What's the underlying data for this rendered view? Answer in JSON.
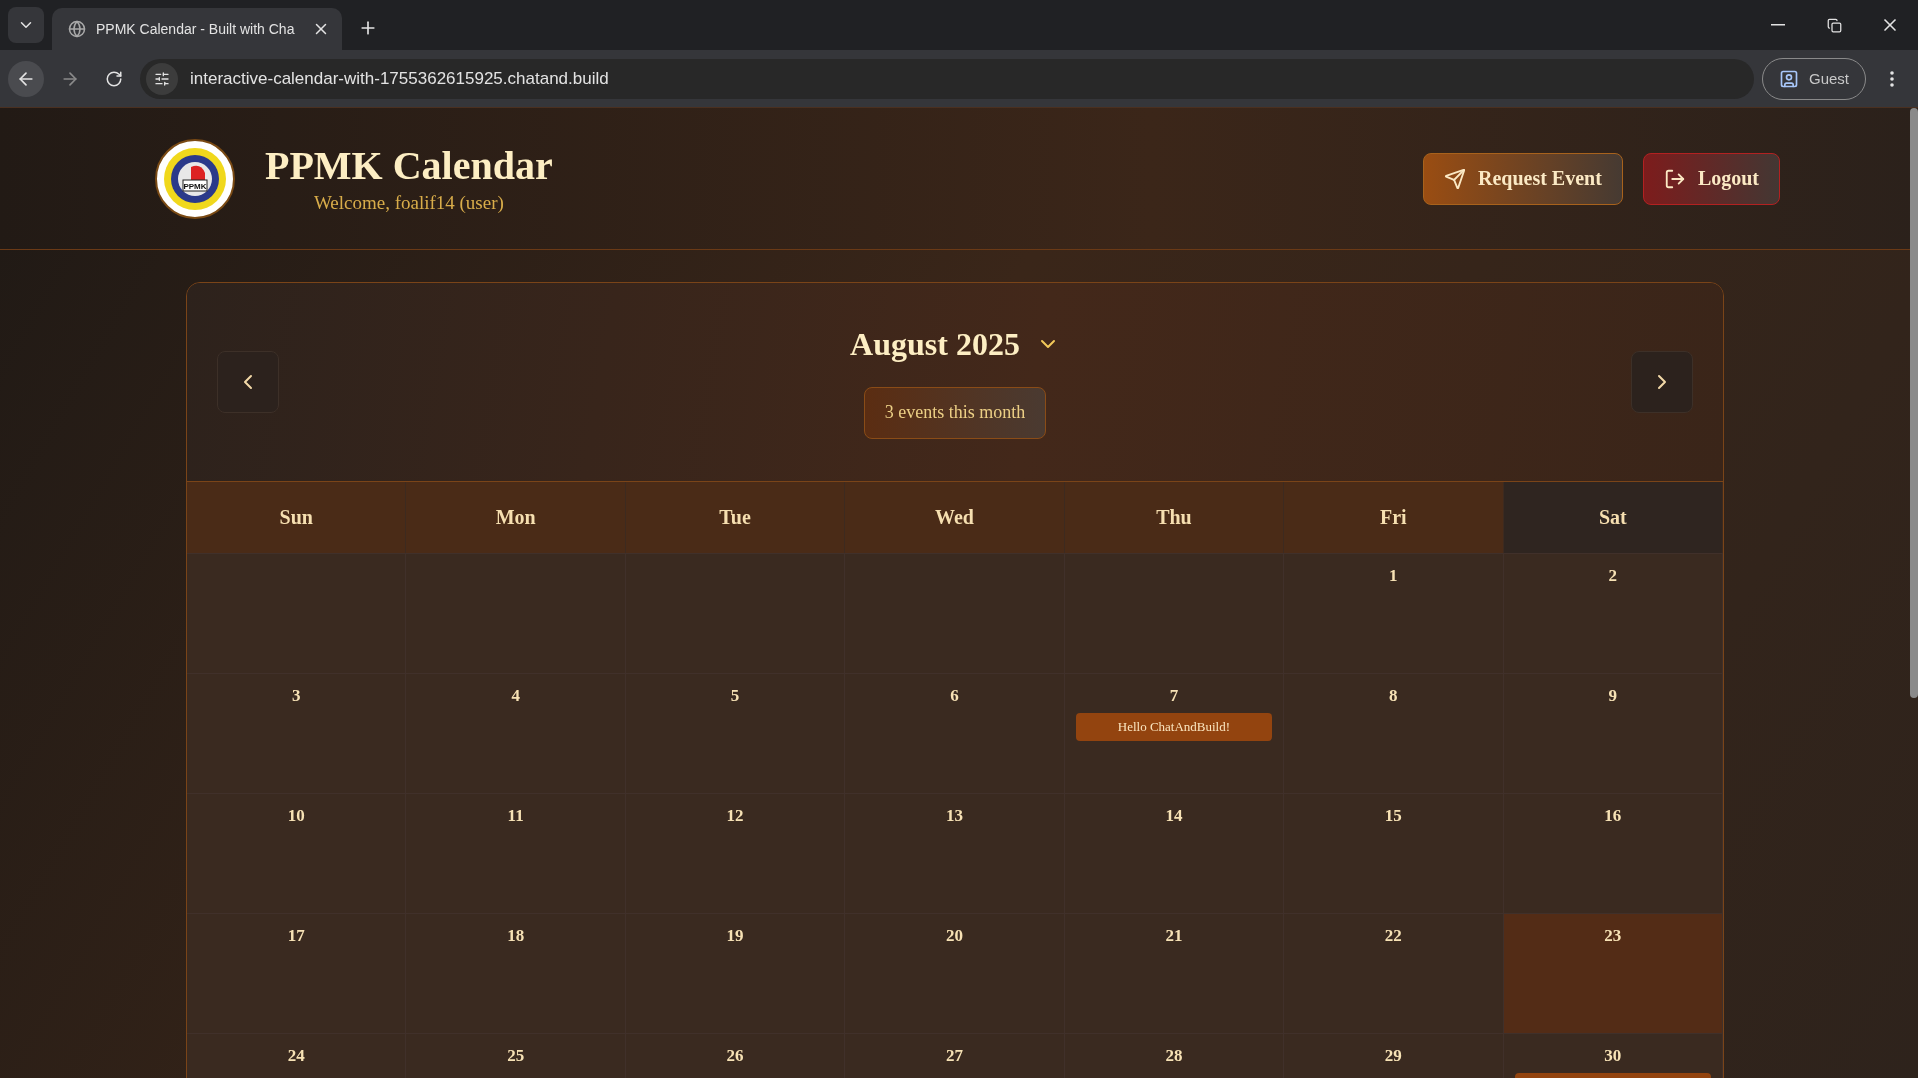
{
  "browser": {
    "tab_title": "PPMK Calendar - Built with Cha",
    "url": "interactive-calendar-with-1755362615925.chatand.build",
    "profile": "Guest"
  },
  "header": {
    "logo_text": "PPMK",
    "title": "PPMK Calendar",
    "welcome": "Welcome, foalif14 (user)",
    "buttons": [
      {
        "kind": "request",
        "label": "Request Event"
      },
      {
        "kind": "logout",
        "label": "Logout"
      }
    ]
  },
  "calendar": {
    "month": "August 2025",
    "event_count": "3 events this month",
    "weekdays": [
      "Sun",
      "Mon",
      "Tue",
      "Wed",
      "Thu",
      "Fri",
      "Sat"
    ],
    "weeks": [
      [
        {
          "today": false
        },
        {
          "today": false
        },
        {
          "today": false
        },
        {
          "today": false
        },
        {
          "today": false
        },
        {
          "day": "1",
          "today": false
        },
        {
          "day": "2",
          "today": false
        }
      ],
      [
        {
          "day": "3",
          "today": false
        },
        {
          "day": "4",
          "today": false
        },
        {
          "day": "5",
          "today": false
        },
        {
          "day": "6",
          "today": false
        },
        {
          "day": "7",
          "today": false,
          "events": [
            "Hello ChatAndBuild!"
          ]
        },
        {
          "day": "8",
          "today": false
        },
        {
          "day": "9",
          "today": false
        }
      ],
      [
        {
          "day": "10",
          "today": false
        },
        {
          "day": "11",
          "today": false
        },
        {
          "day": "12",
          "today": false
        },
        {
          "day": "13",
          "today": false
        },
        {
          "day": "14",
          "today": false
        },
        {
          "day": "15",
          "today": false
        },
        {
          "day": "16",
          "today": false
        }
      ],
      [
        {
          "day": "17",
          "today": false
        },
        {
          "day": "18",
          "today": false
        },
        {
          "day": "19",
          "today": false
        },
        {
          "day": "20",
          "today": false
        },
        {
          "day": "21",
          "today": false
        },
        {
          "day": "22",
          "today": false
        },
        {
          "day": "23",
          "today": true
        }
      ],
      [
        {
          "day": "24",
          "today": false
        },
        {
          "day": "25",
          "today": false
        },
        {
          "day": "26",
          "today": false
        },
        {
          "day": "27",
          "today": false
        },
        {
          "day": "28",
          "today": false
        },
        {
          "day": "29",
          "today": false
        },
        {
          "day": "30",
          "today": false,
          "partial_event": true
        }
      ]
    ]
  }
}
